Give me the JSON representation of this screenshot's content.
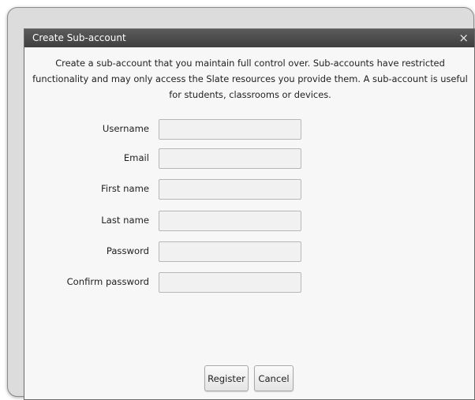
{
  "dialog": {
    "title": "Create Sub-account",
    "close_icon": "×",
    "description": "Create a sub-account that you maintain full control over. Sub-accounts have restricted functionality and may only access the Slate resources you provide them. A sub-account is useful for students, classrooms or devices."
  },
  "form": {
    "username": {
      "label": "Username",
      "value": ""
    },
    "email": {
      "label": "Email",
      "value": ""
    },
    "first_name": {
      "label": "First name",
      "value": ""
    },
    "last_name": {
      "label": "Last name",
      "value": ""
    },
    "password": {
      "label": "Password",
      "value": ""
    },
    "confirm_password": {
      "label": "Confirm password",
      "value": ""
    }
  },
  "buttons": {
    "register": "Register",
    "cancel": "Cancel"
  },
  "colors": {
    "titlebar": "#4a4a4a",
    "dialog_background": "#f7f7f7",
    "field_background": "#f1f1f1",
    "frame_background": "#dcdcdc"
  }
}
